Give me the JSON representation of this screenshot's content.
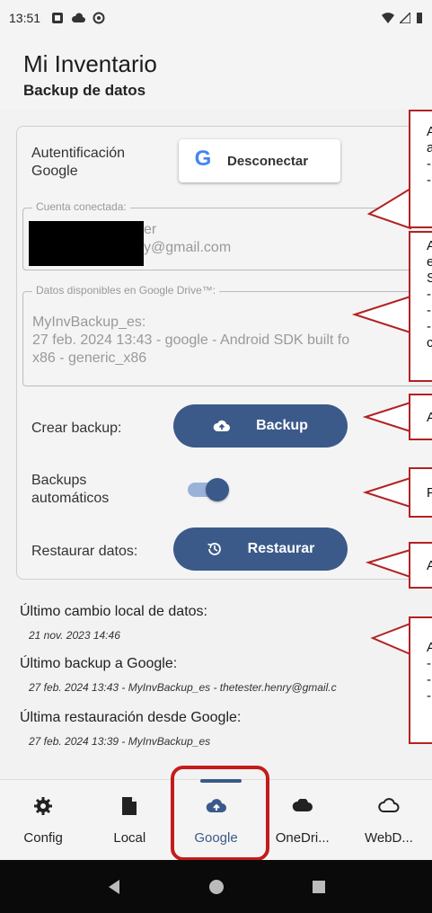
{
  "status_bar": {
    "time": "13:51",
    "icons": [
      "notification-icon",
      "cloud-icon",
      "sync-icon"
    ],
    "right_icons": [
      "wifi-icon",
      "signal-icon",
      "battery-icon"
    ]
  },
  "app": {
    "title": "Mi Inventario",
    "subtitle": "Backup de datos"
  },
  "auth": {
    "label": "Autentificación Google",
    "button_label": "Desconectar",
    "google_letter": "G"
  },
  "account": {
    "legend": "Cuenta conectada:",
    "line1": "er",
    "line2": "y@gmail.com"
  },
  "drive": {
    "legend": "Datos disponibles en Google Drive™:",
    "line1": "MyInvBackup_es:",
    "line2": "27 feb. 2024 13:43 - google - Android SDK built fo",
    "line3": "x86 - generic_x86"
  },
  "backup": {
    "label": "Crear backup:",
    "button_label": "Backup"
  },
  "auto": {
    "label": "Backups automáticos",
    "enabled": true
  },
  "restore": {
    "label": "Restaurar datos:",
    "button_label": "Restaurar"
  },
  "info": {
    "last_local_title": "Último cambio local de datos:",
    "last_local_value": "21 nov. 2023 14:46",
    "last_backup_title": "Último backup a Google:",
    "last_backup_value": "27 feb. 2024 13:43 - MyInvBackup_es - thetester.henry@gmail.c",
    "last_restore_title": "Última restauración desde Google:",
    "last_restore_value": "27 feb. 2024 13:39 - MyInvBackup_es"
  },
  "callouts": [
    {
      "text": "A\na\n-\n-"
    },
    {
      "text": "A\ne\nS\n-\n-\n-\nc"
    },
    {
      "text": "A"
    },
    {
      "text": "F"
    },
    {
      "text": "A"
    },
    {
      "text": "A\n-\n-\n-"
    }
  ],
  "bottom_nav": [
    {
      "label": "Config",
      "icon": "gear-icon"
    },
    {
      "label": "Local",
      "icon": "file-icon"
    },
    {
      "label": "Google",
      "icon": "cloud-upload-icon",
      "active": true
    },
    {
      "label": "OneDri...",
      "icon": "cloud-icon"
    },
    {
      "label": "WebD...",
      "icon": "cloud-outline-icon"
    }
  ],
  "colors": {
    "primary": "#3b5a8a",
    "highlight": "#c41b1b",
    "toggle_track": "#9bb2d8"
  }
}
